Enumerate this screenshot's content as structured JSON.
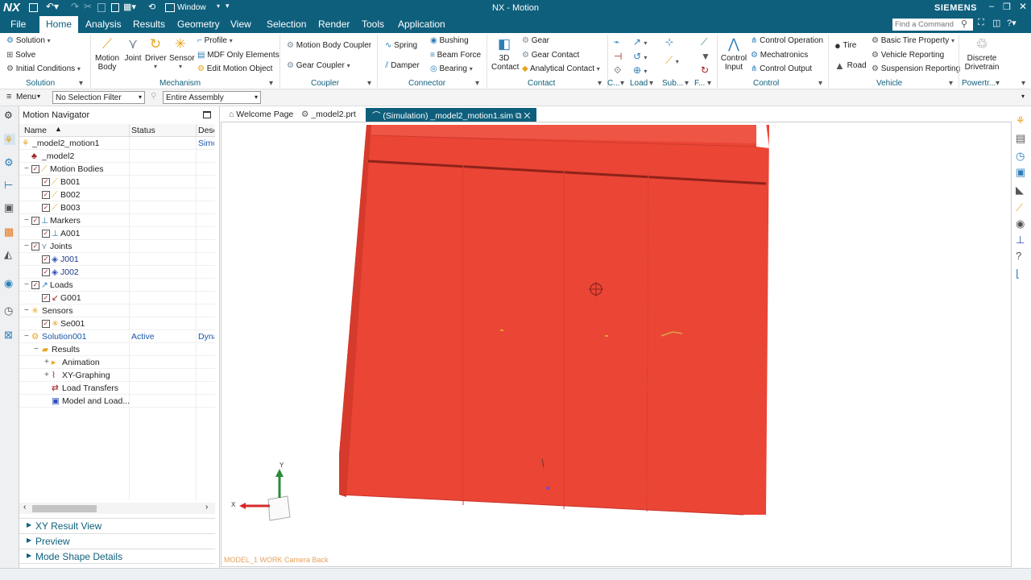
{
  "titlebar": {
    "logo": "NX",
    "window_label": "Window",
    "title": "NX - Motion",
    "brand": "SIEMENS"
  },
  "menubar": {
    "items": [
      "File",
      "Home",
      "Analysis",
      "Results",
      "Geometry",
      "View",
      "Selection",
      "Render",
      "Tools",
      "Application"
    ],
    "search_placeholder": "Find a Command"
  },
  "ribbon": {
    "solution": {
      "items": [
        "Solution",
        "Solve",
        "Initial Conditions"
      ],
      "group": "Solution"
    },
    "mechanism": {
      "buttons": [
        "Motion Body",
        "Joint",
        "Driver",
        "Sensor"
      ],
      "motion_body_line1": "Motion",
      "motion_body_line2": "Body",
      "items": [
        "Profile",
        "MDF Only Elements",
        "Edit Motion Object"
      ],
      "group": "Mechanism"
    },
    "coupler": {
      "items": [
        "Motion Body Coupler",
        "Gear Coupler"
      ],
      "group": "Coupler"
    },
    "connector": {
      "items": [
        "Spring",
        "Damper",
        "Bushing",
        "Beam Force",
        "Bearing"
      ],
      "group": "Connector"
    },
    "contact": {
      "big_line1": "3D",
      "big_line2": "Contact",
      "items": [
        "Gear",
        "Gear Contact",
        "Analytical Contact"
      ],
      "group": "Contact"
    },
    "small_groups": [
      "C...",
      "Load",
      "Sub...",
      "F..."
    ],
    "control": {
      "big_line1": "Control",
      "big_line2": "Input",
      "items": [
        "Control Operation",
        "Mechatronics",
        "Control Output"
      ],
      "group": "Control"
    },
    "vehicle": {
      "items": [
        "Tire",
        "Road",
        "Basic Tire Property",
        "Vehicle Reporting",
        "Suspension Reporting"
      ],
      "group": "Vehicle"
    },
    "powertrain": {
      "big_line1": "Discrete",
      "big_line2": "Drivetrain",
      "group": "Powertr..."
    }
  },
  "selbar": {
    "menu": "Menu",
    "filter": "No Selection Filter",
    "scope": "Entire Assembly"
  },
  "navigator": {
    "title": "Motion Navigator",
    "columns": [
      "Name",
      "Status",
      "Desc"
    ],
    "rows": [
      {
        "name": "_model2_motion1",
        "status": "",
        "desc": "Simc"
      },
      {
        "name": "_model2",
        "status": "",
        "desc": ""
      },
      {
        "name": "Motion Bodies",
        "status": "",
        "desc": ""
      },
      {
        "name": "B001",
        "status": "",
        "desc": ""
      },
      {
        "name": "B002",
        "status": "",
        "desc": ""
      },
      {
        "name": "B003",
        "status": "",
        "desc": ""
      },
      {
        "name": "Markers",
        "status": "",
        "desc": ""
      },
      {
        "name": "A001",
        "status": "",
        "desc": ""
      },
      {
        "name": "Joints",
        "status": "",
        "desc": ""
      },
      {
        "name": "J001",
        "status": "",
        "desc": ""
      },
      {
        "name": "J002",
        "status": "",
        "desc": ""
      },
      {
        "name": "Loads",
        "status": "",
        "desc": ""
      },
      {
        "name": "G001",
        "status": "",
        "desc": ""
      },
      {
        "name": "Sensors",
        "status": "",
        "desc": ""
      },
      {
        "name": "Se001",
        "status": "",
        "desc": ""
      },
      {
        "name": "Solution001",
        "status": "Active",
        "desc": "Dyna"
      },
      {
        "name": "Results",
        "status": "",
        "desc": ""
      },
      {
        "name": "Animation",
        "status": "",
        "desc": ""
      },
      {
        "name": "XY-Graphing",
        "status": "",
        "desc": ""
      },
      {
        "name": "Load Transfers",
        "status": "",
        "desc": ""
      },
      {
        "name": "Model and Load...",
        "status": "",
        "desc": ""
      }
    ],
    "panels": [
      "XY Result View",
      "Preview",
      "Mode Shape Details"
    ]
  },
  "tabs": [
    "Welcome Page",
    "_model2.prt",
    "(Simulation) _model2_motion1.sim"
  ],
  "viewport": {
    "camera_label": "MODEL_1 WORK Camera Back",
    "axis_y": "Y",
    "axis_x": "X"
  },
  "colors": {
    "brand": "#0e5f7c",
    "model": "#ea4535",
    "link": "#1a58a5",
    "axis_y": "#2a8a3a",
    "axis_x": "#d62a2a"
  }
}
